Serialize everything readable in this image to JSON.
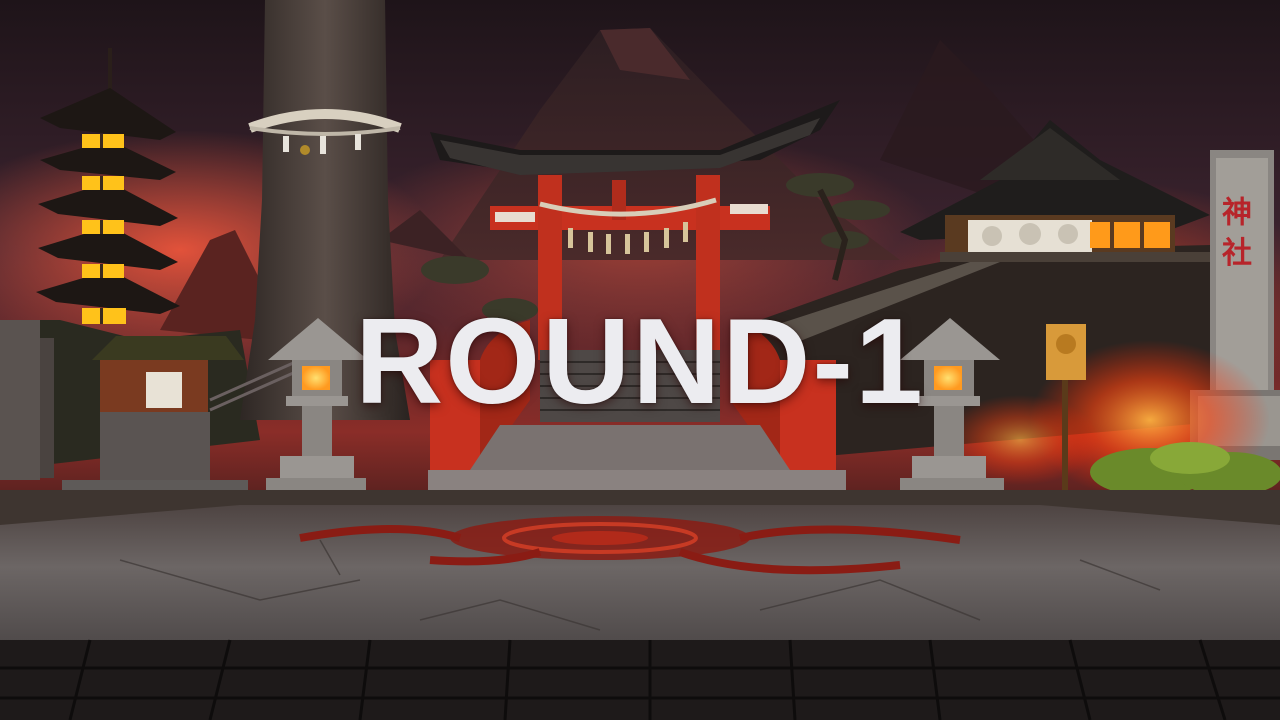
{
  "hud": {
    "round_label": "ROUND-1"
  },
  "scene": {
    "stage_name": "",
    "pillar_inscription": "神 社",
    "elements": {
      "sky": "smoky-dusk-sky",
      "mountain": "volcanic-peak",
      "pagoda": "five-tier-pagoda",
      "tree": "sacred-rope-tree",
      "gate": "torii-gate",
      "bridge": "red-arched-bridge",
      "temple": "hillside-temple",
      "pillar": "stone-inscription-pillar",
      "lanterns": [
        "stone-lantern-left",
        "stone-lantern-right"
      ],
      "arena": "stone-fighting-arena"
    }
  },
  "colors": {
    "sky_top": "#2a1a22",
    "sky_glow": "#d9483a",
    "torii_red": "#c8311f",
    "lantern_glow": "#ffb030",
    "arena_stone": "#6a6464",
    "emblem_red": "#9a1f17",
    "text": "#ececf0"
  }
}
